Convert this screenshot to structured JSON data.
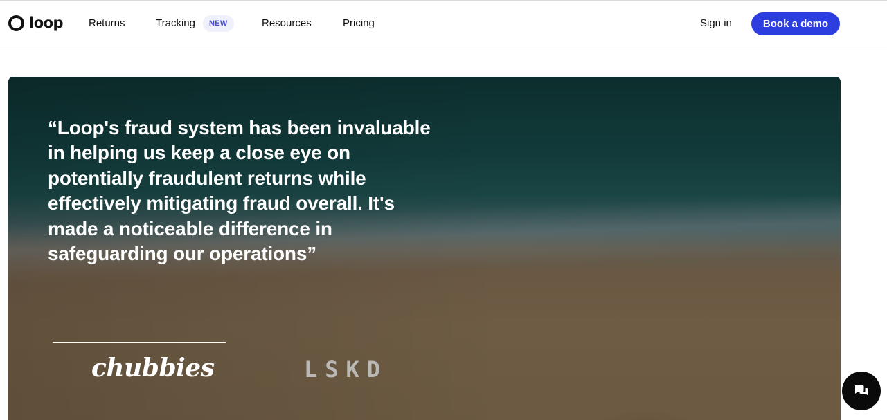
{
  "nav": {
    "logo_text": "loop",
    "items": [
      {
        "label": "Returns"
      },
      {
        "label": "Tracking",
        "badge": "NEW"
      },
      {
        "label": "Resources"
      },
      {
        "label": "Pricing"
      }
    ],
    "sign_in": "Sign in",
    "cta": "Book a demo"
  },
  "hero": {
    "quote": "“Loop's fraud system has been invaluable in helping us keep a close eye on potentially fraudulent returns while effectively mitigating fraud overall. It's made a noticeable difference in safeguarding our operations”",
    "brands": [
      "chubbies",
      "LSKD"
    ]
  },
  "colors": {
    "accent": "#2c3ee0",
    "badge_bg": "#eef0fb",
    "badge_text": "#4a4fd1"
  },
  "icons": {
    "logo": "loop-ring-icon",
    "chat": "chat-bubbles-icon"
  }
}
